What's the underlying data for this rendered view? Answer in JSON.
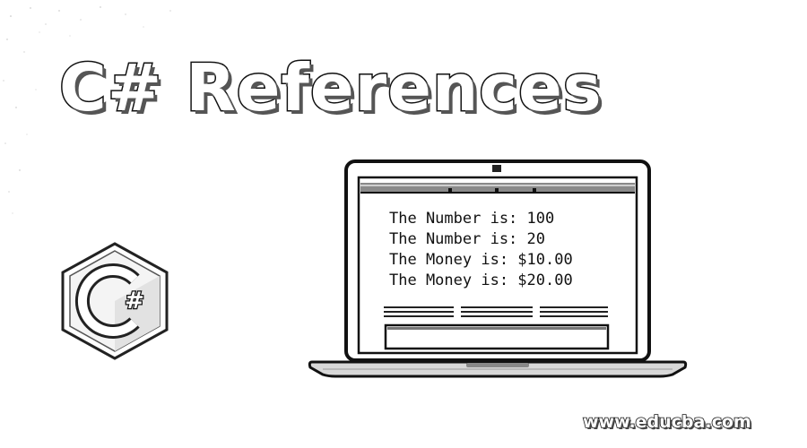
{
  "title": "C# References",
  "logo": {
    "icon": "csharp-logo-icon",
    "glyph": "#"
  },
  "laptop": {
    "icon": "laptop-icon",
    "screen_lines": [
      "The Number is: 100",
      "The Number is: 20",
      "The Money is: $10.00",
      "The Money is: $20.00"
    ]
  },
  "watermark": "www.educba.com"
}
